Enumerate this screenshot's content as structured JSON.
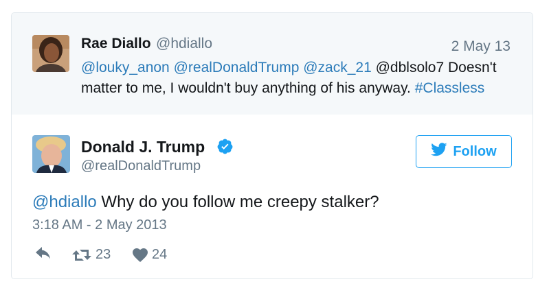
{
  "quoted_tweet": {
    "author_name": "Rae Diallo",
    "author_handle": "@hdiallo",
    "date": "2 May 13",
    "text_parts": {
      "mention1": "@louky_anon",
      "mention2": "@realDonaldTrump",
      "mention3": "@zack_21",
      "plain1": "@dblsolo7 Doesn't matter to me, I wouldn't buy anything of his anyway.",
      "hashtag": "#Classless"
    }
  },
  "main_tweet": {
    "author_name": "Donald J. Trump",
    "author_handle": "@realDonaldTrump",
    "verified_icon": "verified-badge-icon",
    "follow_label": "Follow",
    "mention": "@hdiallo",
    "text": "Why do you follow me creepy stalker?",
    "timestamp": "3:18 AM - 2 May 2013",
    "retweet_count": "23",
    "like_count": "24"
  },
  "colors": {
    "link": "#2b7bb9",
    "follow_accent": "#1da1f2",
    "verified": "#1da1f2",
    "muted": "#657786",
    "quoted_bg": "#f5f8fa"
  }
}
